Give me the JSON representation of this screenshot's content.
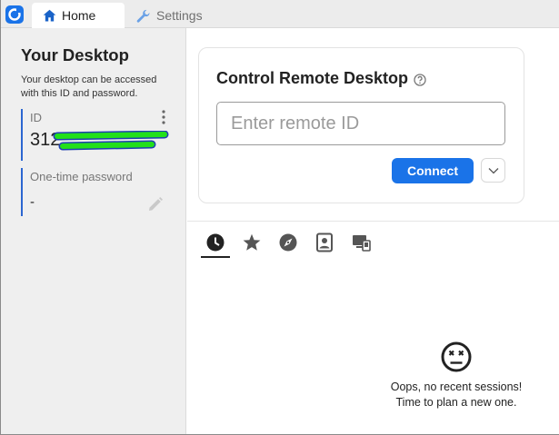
{
  "tabs": [
    {
      "label": "Home",
      "icon": "home-icon",
      "active": true
    },
    {
      "label": "Settings",
      "icon": "wrench-icon",
      "active": false
    }
  ],
  "your_desktop": {
    "title": "Your Desktop",
    "description": "Your desktop can be accessed with this ID and password.",
    "id_label": "ID",
    "id_value": "312",
    "password_label": "One-time password",
    "password_value": "-"
  },
  "control": {
    "title": "Control Remote Desktop",
    "input_placeholder": "Enter remote ID",
    "input_value": "",
    "connect_label": "Connect"
  },
  "session_tabs": [
    {
      "icon": "recent-clock-icon",
      "active": true
    },
    {
      "icon": "favorites-star-icon",
      "active": false
    },
    {
      "icon": "discover-compass-icon",
      "active": false
    },
    {
      "icon": "address-book-icon",
      "active": false
    },
    {
      "icon": "lan-devices-icon",
      "active": false
    }
  ],
  "empty_state": {
    "line1": "Oops, no recent sessions!",
    "line2": "Time to plan a new one."
  },
  "colors": {
    "accent": "#1a73e8",
    "redaction": "#22e01a"
  }
}
